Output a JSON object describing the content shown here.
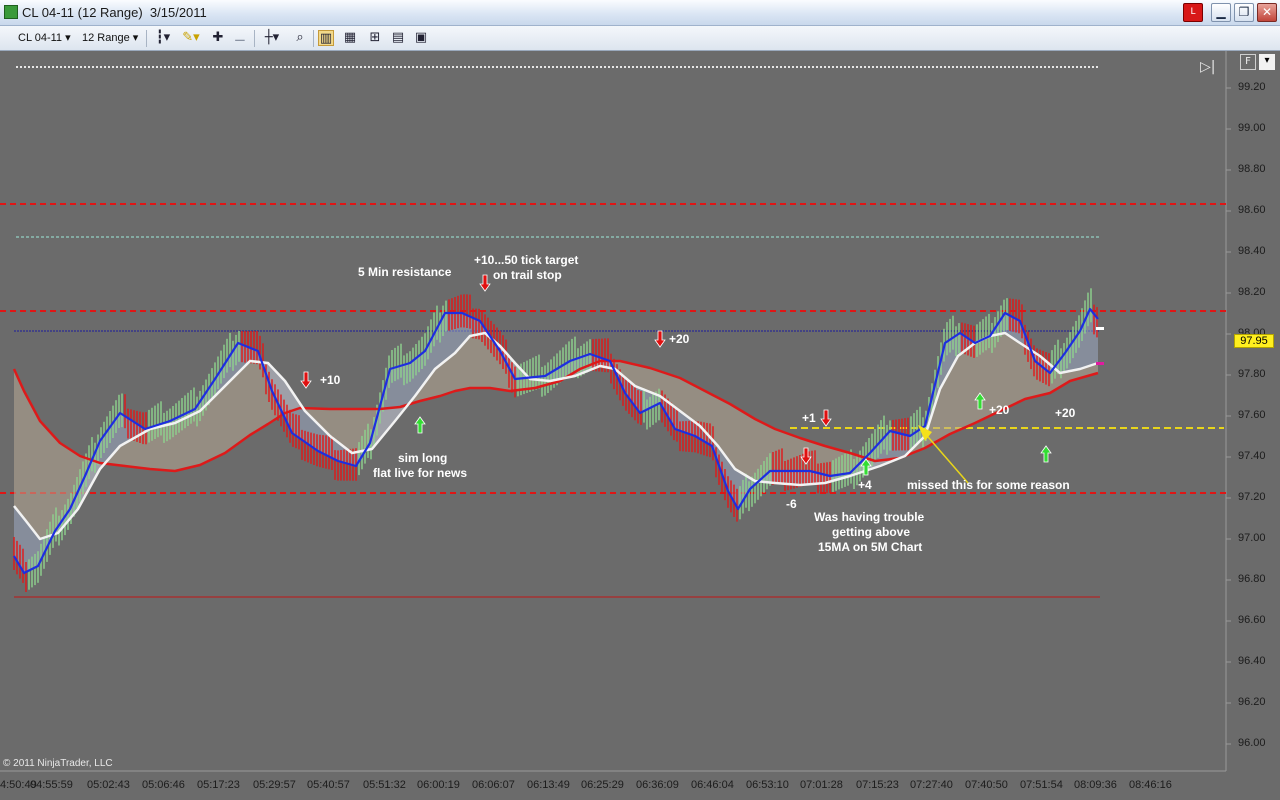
{
  "window": {
    "title": "CL 04-11 (12 Range)  3/15/2011",
    "buttons": {
      "alert": "L",
      "minimize": "▁",
      "maximize": "❐",
      "close": "✕"
    }
  },
  "toolbar": {
    "instrument": "CL 04-11",
    "interval": "12 Range",
    "icons": [
      "bar-type-icon",
      "draw-pencil-icon",
      "add-indicator-icon",
      "remove-indicator-icon",
      "crosshair-icon",
      "zoom-icon",
      "chart-trader-icon",
      "data-box-icon",
      "strategy-icon",
      "properties-icon",
      "properties-panel-icon"
    ]
  },
  "chart": {
    "right_controls": {
      "scroll_end": "▷|",
      "f_button": "F",
      "menu": "▾"
    },
    "price_axis": [
      "99.20",
      "99.00",
      "98.80",
      "98.60",
      "98.40",
      "98.20",
      "98.00",
      "97.80",
      "97.60",
      "97.40",
      "97.20",
      "97.00",
      "96.80",
      "96.60",
      "96.40",
      "96.20",
      "96.00"
    ],
    "time_axis": [
      "4:50:49",
      "04:55:59",
      "05:02:43",
      "05:06:46",
      "05:17:23",
      "05:29:57",
      "05:40:57",
      "05:51:32",
      "06:00:19",
      "06:06:07",
      "06:13:49",
      "06:25:29",
      "06:36:09",
      "06:46:04",
      "06:53:10",
      "07:01:28",
      "07:15:23",
      "07:27:40",
      "07:40:50",
      "07:51:54",
      "08:09:36",
      "08:46:16"
    ],
    "last_price": "97.95",
    "copyright": "© 2011 NinjaTrader, LLC",
    "colors": {
      "background": "#6b6b6b",
      "up_bar": "#8ed48e",
      "down_bar": "#e21818",
      "fast_ma": "#1d2ee0",
      "mid_ma": "#f2f2f2",
      "slow_ma": "#dd1a1a",
      "yellow_line": "#e8d51a"
    },
    "annotations": {
      "min5_resistance": "5 Min resistance",
      "target_line1": "+10...50 tick target",
      "target_line2": "on trail stop",
      "plus10": "+10",
      "sim_long_line1": "sim long",
      "sim_long_line2": "flat live for news",
      "plus20_a": "+20",
      "plus1": "+1",
      "minus6": "-6",
      "plus4": "+4",
      "trouble_line1": "Was having trouble",
      "trouble_line2": "getting above",
      "trouble_line3": "15MA on 5M Chart",
      "missed": "missed this for some reason",
      "plus20_b": "+20",
      "plus20_c": "+20"
    }
  }
}
